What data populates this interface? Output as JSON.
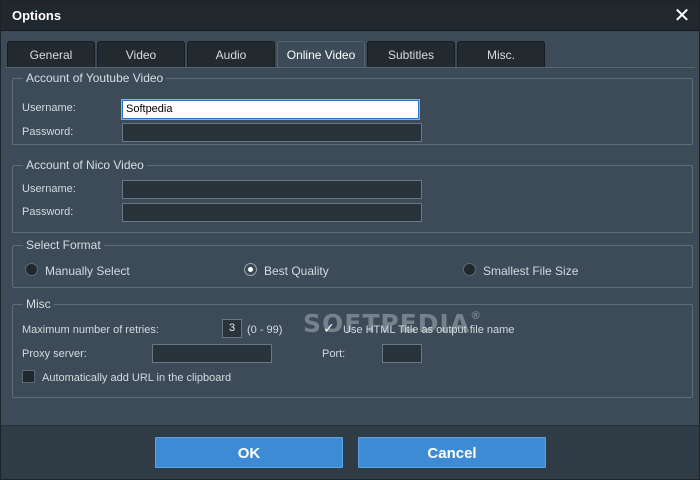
{
  "window": {
    "title": "Options",
    "close_icon": "close-icon"
  },
  "tabs": [
    {
      "label": "General",
      "active": false
    },
    {
      "label": "Video",
      "active": false
    },
    {
      "label": "Audio",
      "active": false
    },
    {
      "label": "Online Video",
      "active": true
    },
    {
      "label": "Subtitles",
      "active": false
    },
    {
      "label": "Misc.",
      "active": false
    }
  ],
  "youtube": {
    "legend": "Account of Youtube Video",
    "username_label": "Username:",
    "username_value": "Softpedia",
    "password_label": "Password:",
    "password_value": ""
  },
  "nico": {
    "legend": "Account of Nico Video",
    "username_label": "Username:",
    "username_value": "",
    "password_label": "Password:",
    "password_value": ""
  },
  "format": {
    "legend": "Select Format",
    "options": [
      {
        "label": "Manually Select",
        "checked": false
      },
      {
        "label": "Best Quality",
        "checked": true
      },
      {
        "label": "Smallest File Size",
        "checked": false
      }
    ]
  },
  "misc": {
    "legend": "Misc",
    "retries_label": "Maximum number of retries:",
    "retries_value": "3",
    "retries_range": "(0 - 99)",
    "html_title_label": "Use HTML Title as output file name",
    "html_title_checked": true,
    "proxy_label": "Proxy server:",
    "proxy_value": "",
    "port_label": "Port:",
    "port_value": "",
    "clipboard_label": "Automatically add URL in the clipboard",
    "clipboard_checked": false
  },
  "watermark": {
    "text": "SOFTPEDIA",
    "mark": "®"
  },
  "footer": {
    "ok_label": "OK",
    "cancel_label": "Cancel"
  },
  "colors": {
    "accent": "#3d8bd4",
    "background": "#3c4b57",
    "titlebar": "#20272d"
  }
}
